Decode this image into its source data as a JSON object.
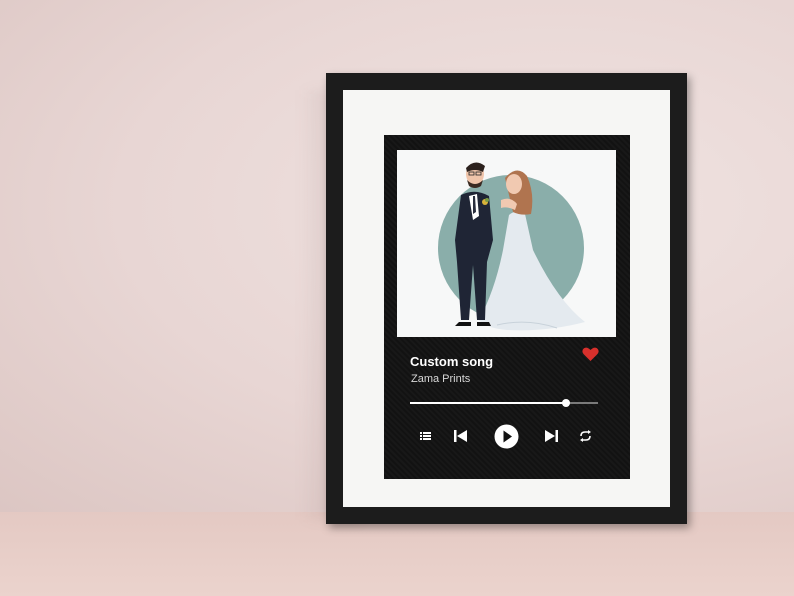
{
  "song": {
    "title": "Custom song",
    "artist": "Zama Prints",
    "progress": 0.83,
    "liked": true
  },
  "colors": {
    "heart": "#d8302c",
    "circle": "#8aaeaa",
    "poster": "#121212"
  },
  "controls": [
    "queue-icon",
    "previous-icon",
    "play-icon",
    "next-icon",
    "repeat-icon"
  ]
}
